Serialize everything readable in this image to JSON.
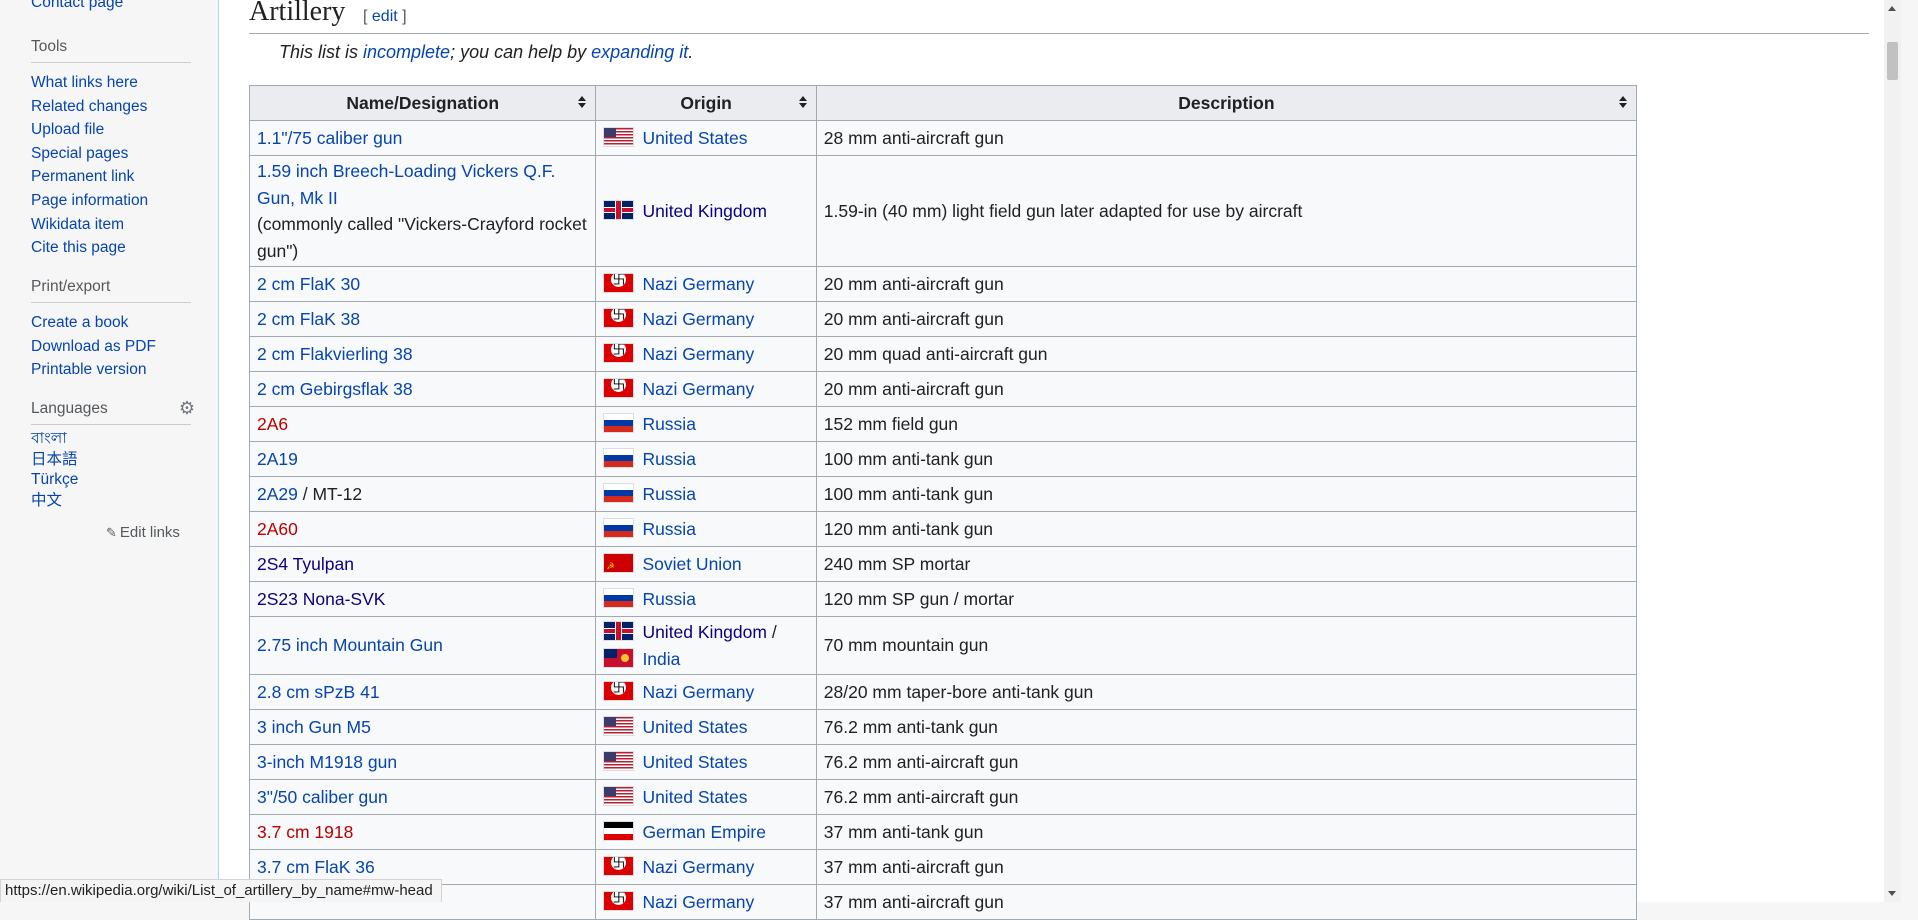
{
  "sidebar": {
    "top_link": "Contact page",
    "tools": {
      "heading": "Tools",
      "items": [
        "What links here",
        "Related changes",
        "Upload file",
        "Special pages",
        "Permanent link",
        "Page information",
        "Wikidata item",
        "Cite this page"
      ]
    },
    "print": {
      "heading": "Print/export",
      "items": [
        "Create a book",
        "Download as PDF",
        "Printable version"
      ]
    },
    "languages": {
      "heading": "Languages",
      "items": [
        "বাংলা",
        "日本語",
        "Türkçe",
        "中文"
      ],
      "edit_links": "Edit links"
    }
  },
  "section": {
    "title": "Artillery",
    "edit_open": "[ ",
    "edit_label": "edit",
    "edit_close": " ]"
  },
  "hatnote": {
    "pre": "This list is ",
    "link1": "incomplete",
    "mid": "; you can help by ",
    "link2": "expanding it",
    "post": "."
  },
  "table": {
    "headers": [
      "Name/Designation",
      "Origin",
      "Description"
    ],
    "rows": [
      {
        "name": "1.1\"/75 caliber gun",
        "origin": "United States",
        "flag": "us",
        "desc": "28 mm anti-aircraft gun"
      },
      {
        "name": "1.59 inch Breech-Loading Vickers Q.F. Gun, Mk II",
        "note": "(commonly called \"Vickers-Crayford rocket gun\")",
        "origin": "United Kingdom",
        "flag": "uk",
        "desc": "1.59-in (40 mm) light field gun later adapted for use by aircraft"
      },
      {
        "name": "2 cm FlaK 30",
        "origin": "Nazi Germany",
        "flag": "nz",
        "desc": "20 mm anti-aircraft gun"
      },
      {
        "name": "2 cm FlaK 38",
        "origin": "Nazi Germany",
        "flag": "nz",
        "desc": "20 mm anti-aircraft gun"
      },
      {
        "name": "2 cm Flakvierling 38",
        "origin": "Nazi Germany",
        "flag": "nz",
        "desc": "20 mm quad anti-aircraft gun"
      },
      {
        "name": "2 cm Gebirgsflak 38",
        "origin": "Nazi Germany",
        "flag": "nz",
        "desc": "20 mm anti-aircraft gun"
      },
      {
        "name": "2A6",
        "red": true,
        "origin": "Russia",
        "flag": "ru",
        "desc": "152 mm field gun"
      },
      {
        "name": "2A19",
        "origin": "Russia",
        "flag": "ru",
        "desc": "100 mm anti-tank gun"
      },
      {
        "name": "2A29",
        "suffix": " / MT-12",
        "origin": "Russia",
        "flag": "ru",
        "desc": "100 mm anti-tank gun"
      },
      {
        "name": "2A60",
        "red": true,
        "origin": "Russia",
        "flag": "ru",
        "desc": "120 mm anti-tank gun"
      },
      {
        "name": "2S4 Tyulpan",
        "origin": "Soviet Union",
        "flag": "su",
        "desc": "240 mm SP mortar"
      },
      {
        "name": "2S23 Nona-SVK",
        "origin": "Russia",
        "flag": "ru",
        "desc": "120 mm SP gun / mortar"
      },
      {
        "name": "2.75 inch Mountain Gun",
        "origin": "United Kingdom",
        "origin_sep": " /",
        "flag": "uk",
        "origin2": "India",
        "flag2": "in",
        "desc": "70 mm mountain gun"
      },
      {
        "name": "2.8 cm sPzB 41",
        "origin": "Nazi Germany",
        "flag": "nz",
        "desc": "28/20 mm taper-bore anti-tank gun"
      },
      {
        "name": "3 inch Gun M5",
        "origin": "United States",
        "flag": "us",
        "desc": "76.2 mm anti-tank gun"
      },
      {
        "name": "3-inch M1918 gun",
        "origin": "United States",
        "flag": "us",
        "desc": "76.2 mm anti-aircraft gun"
      },
      {
        "name": "3\"/50 caliber gun",
        "origin": "United States",
        "flag": "us",
        "desc": "76.2 mm anti-aircraft gun"
      },
      {
        "name": "3.7 cm 1918",
        "red": true,
        "origin": "German Empire",
        "flag": "de",
        "desc": "37 mm anti-tank gun"
      },
      {
        "name": "3.7 cm FlaK 36",
        "origin": "Nazi Germany",
        "flag": "nz",
        "desc": "37 mm anti-aircraft gun"
      },
      {
        "name": "",
        "origin": "Nazi Germany",
        "flag": "nz",
        "desc": "37 mm anti-aircraft gun"
      }
    ]
  },
  "status_url": "https://en.wikipedia.org/wiki/List_of_artillery_by_name#mw-head"
}
